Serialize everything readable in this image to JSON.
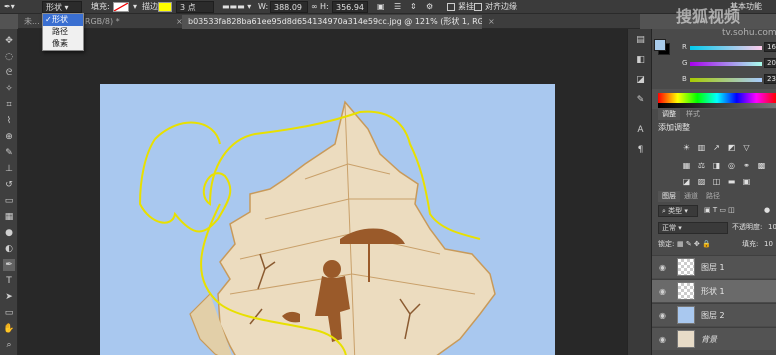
{
  "watermark": {
    "brand_text": "搜狐视频",
    "url": "tv.sohu.com"
  },
  "options_bar": {
    "tool_mode_value": "形状",
    "fill_label": "填充:",
    "stroke_label": "描边:",
    "stroke_width": "3 点",
    "width_label": "W:",
    "width_value": "388.09",
    "height_label": "H:",
    "height_value": "356.94",
    "option_1": "紧挂",
    "option_2": "对齐边缘",
    "workspace_label": "基本功能",
    "colors": {
      "fill_swatch": "#ffffff",
      "stroke_swatch": "#ffff00"
    }
  },
  "mode_dropdown": {
    "options": [
      "形状",
      "路径",
      "像素"
    ],
    "selected_index": 0
  },
  "document_tabs": [
    {
      "label": "未...  (背景 副本, RGB/8) *",
      "active": false
    },
    {
      "label": "b03533fa828ba61ee95d8d654134970a314e59cc.jpg @ 121% (形状 1, RGB/8#) *",
      "active": true
    }
  ],
  "color_panel": {
    "channels": [
      {
        "label": "R",
        "value": "168"
      },
      {
        "label": "G",
        "value": "203"
      },
      {
        "label": "B",
        "value": "235"
      }
    ],
    "foreground_color": "#a8cbeb",
    "background_color": "#000000"
  },
  "adjustments_panel": {
    "tabs": [
      "调整",
      "样式"
    ],
    "title": "添加调整"
  },
  "layers_panel": {
    "tabs": [
      "图层",
      "通道",
      "路径"
    ],
    "filter_kind": "类型",
    "blend_mode": "正常",
    "opacity_label": "不透明度:",
    "opacity_value": "10",
    "lock_label": "锁定:",
    "fill_label": "填充:",
    "fill_value": "10",
    "layers": [
      {
        "name": "图层 1",
        "selected": false,
        "italic": false
      },
      {
        "name": "形状 1",
        "selected": true,
        "italic": false
      },
      {
        "name": "图层 2",
        "selected": false,
        "italic": false
      },
      {
        "name": "背景",
        "selected": false,
        "italic": true
      }
    ]
  }
}
